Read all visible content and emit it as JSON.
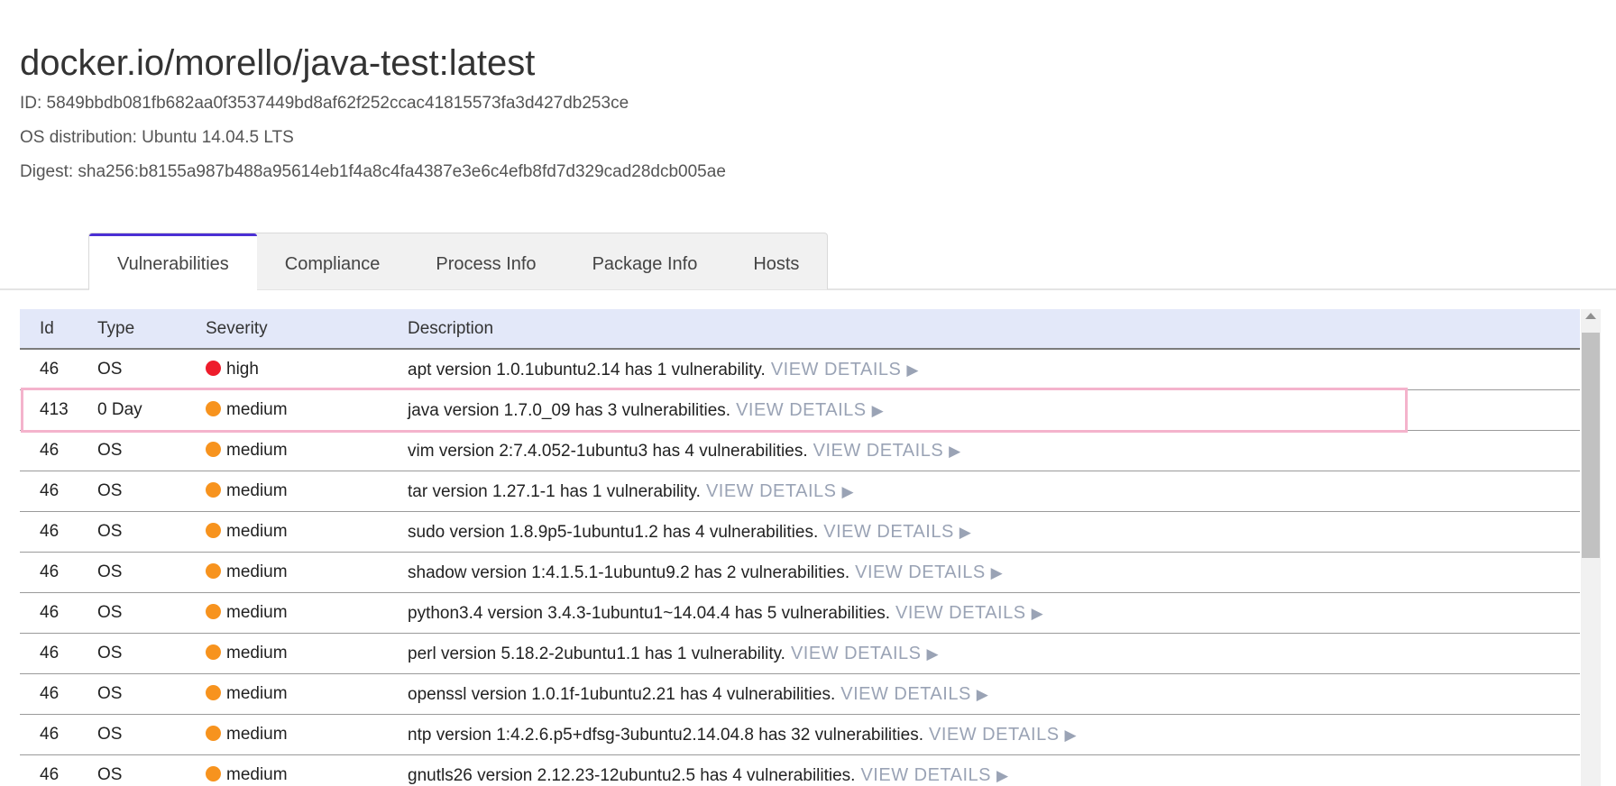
{
  "header": {
    "title": "docker.io/morello/java-test:latest",
    "id_line": "ID: 5849bbdb081fb682aa0f3537449bd8af62f252ccac41815573fa3d427db253ce",
    "os_line": "OS distribution: Ubuntu 14.04.5 LTS",
    "digest_line": "Digest: sha256:b8155a987b488a95614eb1f4a8c4fa4387e3e6c4efb8fd7d329cad28dcb005ae"
  },
  "tabs": [
    {
      "label": "Vulnerabilities",
      "active": true
    },
    {
      "label": "Compliance",
      "active": false
    },
    {
      "label": "Process Info",
      "active": false
    },
    {
      "label": "Package Info",
      "active": false
    },
    {
      "label": "Hosts",
      "active": false
    }
  ],
  "table": {
    "columns": [
      "Id",
      "Type",
      "Severity",
      "Description"
    ],
    "view_details_label": "VIEW DETAILS",
    "severity_colors": {
      "high": "#ee1c2b",
      "medium": "#f7931e"
    },
    "rows": [
      {
        "id": "46",
        "type": "OS",
        "severity": "high",
        "description": "apt version 1.0.1ubuntu2.14 has 1 vulnerability."
      },
      {
        "id": "413",
        "type": "0 Day",
        "severity": "medium",
        "description": "java version 1.7.0_09 has 3 vulnerabilities.",
        "highlighted": true
      },
      {
        "id": "46",
        "type": "OS",
        "severity": "medium",
        "description": "vim version 2:7.4.052-1ubuntu3 has 4 vulnerabilities."
      },
      {
        "id": "46",
        "type": "OS",
        "severity": "medium",
        "description": "tar version 1.27.1-1 has 1 vulnerability."
      },
      {
        "id": "46",
        "type": "OS",
        "severity": "medium",
        "description": "sudo version 1.8.9p5-1ubuntu1.2 has 4 vulnerabilities."
      },
      {
        "id": "46",
        "type": "OS",
        "severity": "medium",
        "description": "shadow version 1:4.1.5.1-1ubuntu9.2 has 2 vulnerabilities."
      },
      {
        "id": "46",
        "type": "OS",
        "severity": "medium",
        "description": "python3.4 version 3.4.3-1ubuntu1~14.04.4 has 5 vulnerabilities."
      },
      {
        "id": "46",
        "type": "OS",
        "severity": "medium",
        "description": "perl version 5.18.2-2ubuntu1.1 has 1 vulnerability."
      },
      {
        "id": "46",
        "type": "OS",
        "severity": "medium",
        "description": "openssl version 1.0.1f-1ubuntu2.21 has 4 vulnerabilities."
      },
      {
        "id": "46",
        "type": "OS",
        "severity": "medium",
        "description": "ntp version 1:4.2.6.p5+dfsg-3ubuntu2.14.04.8 has 32 vulnerabilities."
      },
      {
        "id": "46",
        "type": "OS",
        "severity": "medium",
        "description": "gnutls26 version 2.12.23-12ubuntu2.5 has 4 vulnerabilities."
      }
    ]
  }
}
